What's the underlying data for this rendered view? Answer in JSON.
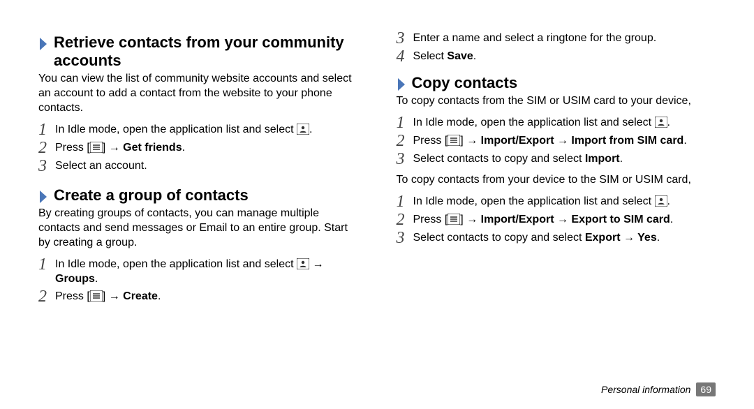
{
  "left": {
    "sec1": {
      "heading": "Retrieve contacts from your community accounts",
      "intro": "You can view the list of community website accounts and select an account to add a contact from the website to your phone contacts.",
      "steps": {
        "s1": {
          "num": "1",
          "text_a": "In Idle mode, open the application list and select ",
          "text_b": "."
        },
        "s2": {
          "num": "2",
          "text_a": "Press [",
          "text_b": "] → ",
          "bold": "Get friends",
          "text_c": "."
        },
        "s3": {
          "num": "3",
          "text": "Select an account."
        }
      }
    },
    "sec2": {
      "heading": "Create a group of contacts",
      "intro": "By creating groups of contacts, you can manage multiple contacts and send messages or Email to an entire group. Start by creating a group.",
      "steps": {
        "s1": {
          "num": "1",
          "text_a": "In Idle mode, open the application list and select ",
          "text_b": " → ",
          "bold": "Groups",
          "text_c": "."
        },
        "s2": {
          "num": "2",
          "text_a": "Press [",
          "text_b": "] → ",
          "bold": "Create",
          "text_c": "."
        }
      }
    }
  },
  "right": {
    "cont_steps": {
      "s3": {
        "num": "3",
        "text": "Enter a name and select a ringtone for the group."
      },
      "s4": {
        "num": "4",
        "text_a": "Select ",
        "bold": "Save",
        "text_b": "."
      }
    },
    "sec1": {
      "heading": "Copy contacts",
      "intro1": "To copy contacts from the SIM or USIM card to your device,",
      "steps1": {
        "s1": {
          "num": "1",
          "text_a": "In Idle mode, open the application list and select ",
          "text_b": "."
        },
        "s2": {
          "num": "2",
          "text_a": "Press [",
          "text_b": "] → ",
          "bold": "Import/Export → Import from SIM card",
          "text_c": "."
        },
        "s3": {
          "num": "3",
          "text_a": "Select contacts to copy and select ",
          "bold": "Import",
          "text_b": "."
        }
      },
      "intro2": "To copy contacts from your device to the SIM or USIM card,",
      "steps2": {
        "s1": {
          "num": "1",
          "text_a": "In Idle mode, open the application list and select ",
          "text_b": "."
        },
        "s2": {
          "num": "2",
          "text_a": "Press [",
          "text_b": "] → ",
          "bold": "Import/Export → Export to SIM card",
          "text_c": "."
        },
        "s3": {
          "num": "3",
          "text_a": "Select contacts to copy and select ",
          "bold": "Export → Yes",
          "text_b": "."
        }
      }
    }
  },
  "footer": {
    "section": "Personal information",
    "page": "69"
  }
}
